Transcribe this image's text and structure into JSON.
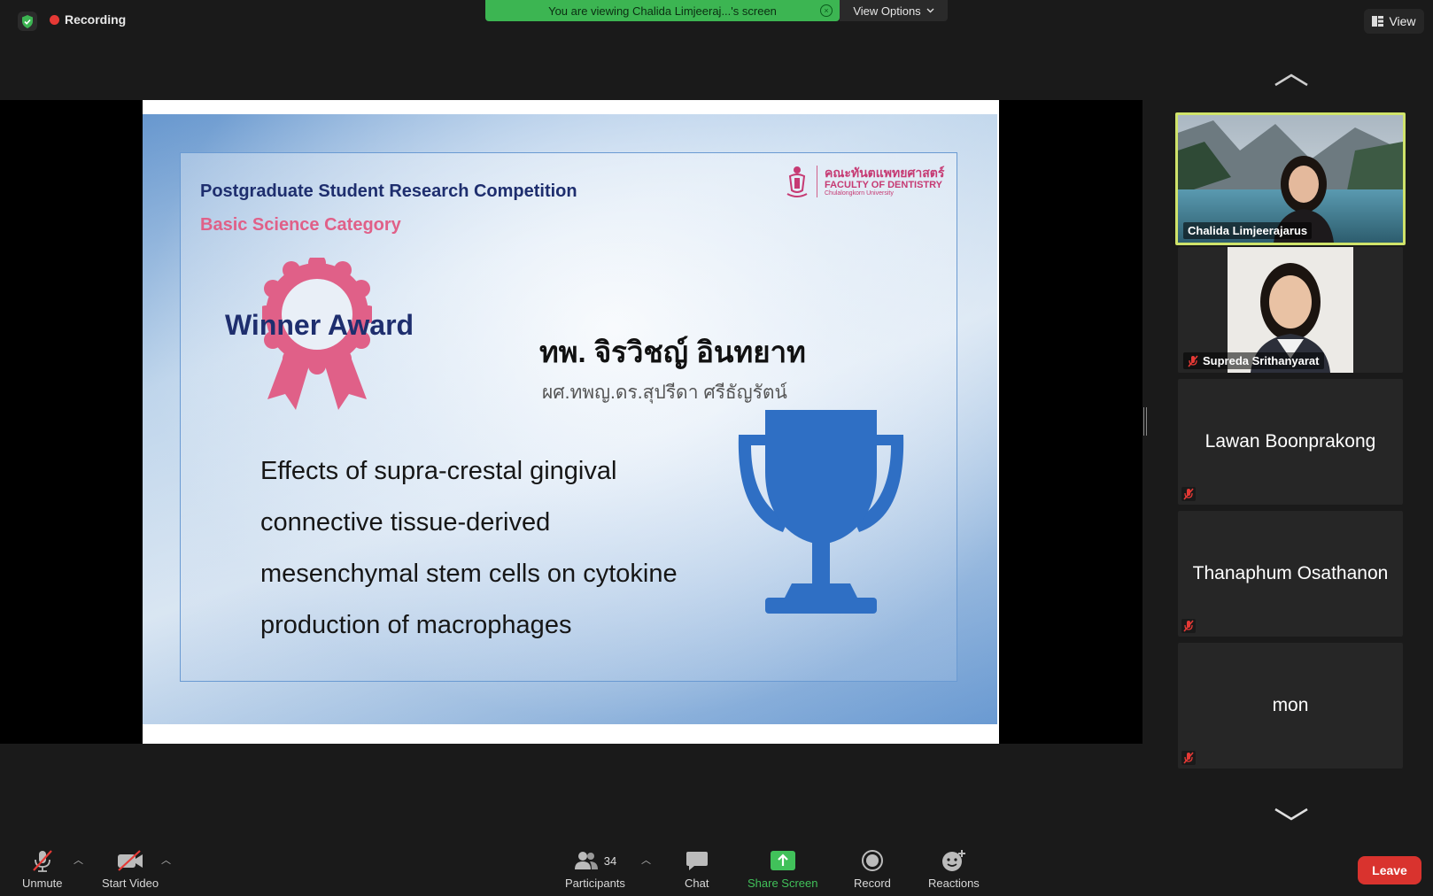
{
  "top": {
    "recording_label": "Recording",
    "banner_text": "You are viewing Chalida Limjeeraj...'s screen",
    "view_options_label": "View Options",
    "view_label": "View"
  },
  "slide": {
    "competition": "Postgraduate Student Research Competition",
    "category": "Basic Science Category",
    "logo_th": "คณะทันตแพทยศาสตร์",
    "logo_en": "FACULTY OF DENTISTRY",
    "logo_sub": "Chulalongkorn University",
    "award": "Winner Award",
    "name_th": "ทพ. จิรวิชญ์ อินทยาท",
    "advisor_th": "ผศ.ทพญ.ดร.สุปรีดา ศรีธัญรัตน์",
    "research_title_lines": [
      "Effects of supra-crestal gingival",
      "connective tissue-derived",
      "mesenchymal stem cells on cytokine",
      "production of macrophages"
    ],
    "colors": {
      "navy": "#1e2e6e",
      "pink": "#e06088",
      "trophy": "#2f6fc4"
    }
  },
  "participants": [
    {
      "name": "Chalida Limjeerajarus",
      "active": true,
      "muted": false
    },
    {
      "name": "Supreda Srithanyarat",
      "muted": true
    },
    {
      "name": "Lawan Boonprakong",
      "muted": true
    },
    {
      "name": "Thanaphum Osathanon",
      "muted": true
    },
    {
      "name": "mon",
      "muted": true
    }
  ],
  "toolbar": {
    "unmute": "Unmute",
    "start_video": "Start Video",
    "participants": "Participants",
    "participants_count": "34",
    "chat": "Chat",
    "share_screen": "Share Screen",
    "record": "Record",
    "reactions": "Reactions",
    "leave": "Leave"
  },
  "colors": {
    "share_green": "#41c15a",
    "leave_red": "#d9332e",
    "active_border": "#cfe36a"
  }
}
